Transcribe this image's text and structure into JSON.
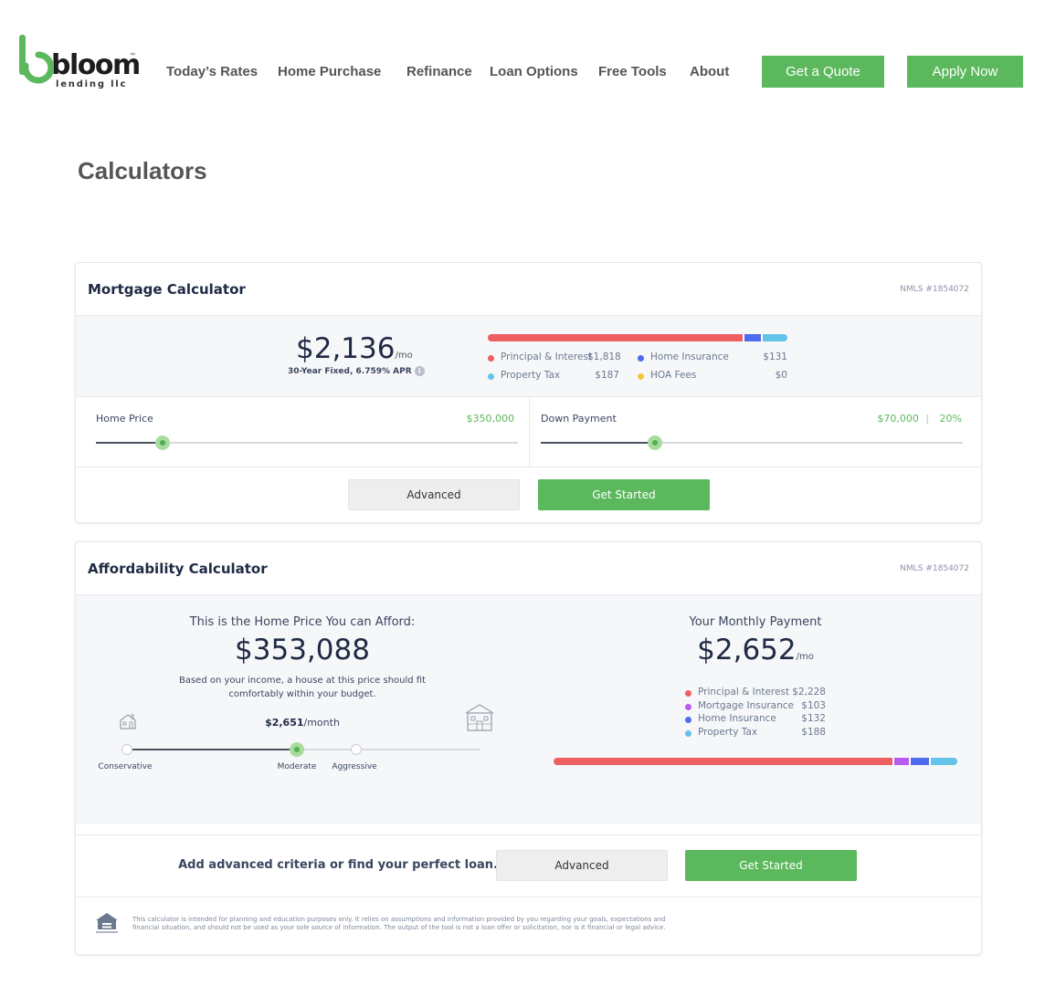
{
  "brand": {
    "name": "bloom",
    "sub": "lending llc",
    "tm": "™",
    "green": "#5cb85c"
  },
  "nav": {
    "links": [
      "Today’s Rates",
      "Home Purchase",
      "Refinance",
      "Loan Options",
      "Free Tools",
      "About"
    ],
    "quote_label": "Get a Quote",
    "apply_label": "Apply Now"
  },
  "page": {
    "title": "Calculators"
  },
  "mortgage": {
    "title": "Mortgage Calculator",
    "nmls": "NMLS #1854072",
    "payment": "$2,136",
    "per": "/mo",
    "rate_note": "30-Year Fixed, 6.759% APR",
    "info_icon": "info-icon",
    "breakdown": [
      {
        "label": "Principal & Interest",
        "value": "$1,818",
        "amount": 1818,
        "color": "#ee5f62"
      },
      {
        "label": "Home Insurance",
        "value": "$131",
        "amount": 131,
        "color": "#4f6bf0"
      },
      {
        "label": "Property Tax",
        "value": "$187",
        "amount": 187,
        "color": "#63c3e8"
      },
      {
        "label": "HOA Fees",
        "value": "$0",
        "amount": 0,
        "color": "#f5c542"
      }
    ],
    "home_price": {
      "label": "Home Price",
      "value": "$350,000",
      "slider_fraction": 0.157
    },
    "down_payment": {
      "label": "Down Payment",
      "value": "$70,000",
      "separator": "|",
      "percent": "20%",
      "slider_fraction": 0.27
    },
    "advanced_label": "Advanced",
    "start_label": "Get Started"
  },
  "affordability": {
    "title": "Affordability Calculator",
    "nmls": "NMLS #1854072",
    "afford_heading": "This is the Home Price You can Afford:",
    "afford_price": "$353,088",
    "afford_note_1": "Based on your income, a house at this price should fit",
    "afford_note_2": "comfortably within your budget.",
    "monthly_amount": "$2,651",
    "monthly_unit": "/month",
    "levels": [
      "Conservative",
      "Moderate",
      "Aggressive"
    ],
    "selected_level": "Moderate",
    "monthly_heading": "Your Monthly Payment",
    "monthly_payment": "$2,652",
    "per": "/mo",
    "breakdown": [
      {
        "label": "Principal & Interest",
        "value": "$2,228",
        "amount": 2228,
        "color": "#ee5f62"
      },
      {
        "label": "Mortgage Insurance",
        "value": "$103",
        "amount": 103,
        "color": "#b65cf0"
      },
      {
        "label": "Home Insurance",
        "value": "$132",
        "amount": 132,
        "color": "#4f6bf0"
      },
      {
        "label": "Property Tax",
        "value": "$188",
        "amount": 188,
        "color": "#63c3e8"
      }
    ],
    "cta_text": "Add advanced criteria or find your perfect loan.",
    "advanced_label": "Advanced",
    "start_label": "Get Started",
    "disclaimer_1": "This calculator is intended for planning and education purposes only. It relies on assumptions and information provided by you regarding your goals, expectations and",
    "disclaimer_2": "financial situation, and should not be used as your sole source of information. The output of the tool is not a loan offer or solicitation, nor is it financial or legal advice."
  }
}
